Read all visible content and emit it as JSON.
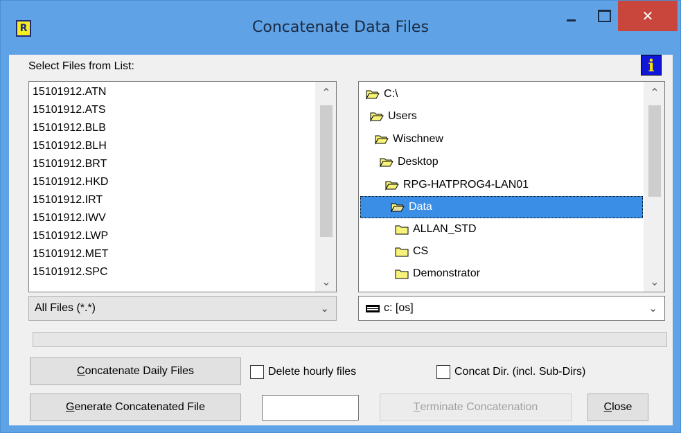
{
  "window": {
    "title": "Concatenate Data Files",
    "app_icon_letter": "R",
    "controls": {
      "close_glyph": "✕"
    }
  },
  "labels": {
    "select_files": "Select Files from List:"
  },
  "info_icon_glyph": "i",
  "file_list": {
    "items": [
      "15101912.ATN",
      "15101912.ATS",
      "15101912.BLB",
      "15101912.BLH",
      "15101912.BRT",
      "15101912.HKD",
      "15101912.IRT",
      "15101912.IWV",
      "15101912.LWP",
      "15101912.MET",
      "15101912.SPC"
    ]
  },
  "dir_list": {
    "items": [
      {
        "label": "C:\\",
        "icon": "open-folder-icon",
        "selected": false
      },
      {
        "label": "Users",
        "icon": "open-folder-icon",
        "selected": false
      },
      {
        "label": "Wischnew",
        "icon": "open-folder-icon",
        "selected": false
      },
      {
        "label": "Desktop",
        "icon": "open-folder-icon",
        "selected": false
      },
      {
        "label": "RPG-HATPROG4-LAN01",
        "icon": "open-folder-icon",
        "selected": false
      },
      {
        "label": "Data",
        "icon": "open-folder-icon",
        "selected": true
      },
      {
        "label": "ALLAN_STD",
        "icon": "closed-folder-icon",
        "selected": false
      },
      {
        "label": "CS",
        "icon": "closed-folder-icon",
        "selected": false
      },
      {
        "label": "Demonstrator",
        "icon": "closed-folder-icon",
        "selected": false
      }
    ]
  },
  "file_filter": {
    "selected": "All Files (*.*)"
  },
  "drive_select": {
    "selected": "c: [os]"
  },
  "progress": {
    "value": 0
  },
  "buttons": {
    "concat_daily": {
      "accel": "C",
      "rest": "oncatenate Daily Files"
    },
    "generate": {
      "accel": "G",
      "rest": "enerate Concatenated File"
    },
    "terminate": {
      "accel": "T",
      "rest": "erminate Concatenation"
    },
    "close": {
      "accel": "C",
      "rest": "lose"
    }
  },
  "checkboxes": {
    "delete_hourly": {
      "label": "Delete hourly files",
      "checked": false
    },
    "concat_dir": {
      "label": "Concat Dir. (incl. Sub-Dirs)",
      "checked": false
    }
  },
  "text_field": {
    "value": ""
  },
  "colors": {
    "titlebar": "#5fa3e6",
    "close_button": "#c9463d",
    "selection": "#3a8ee6",
    "folder_fill": "#f7f27a"
  }
}
